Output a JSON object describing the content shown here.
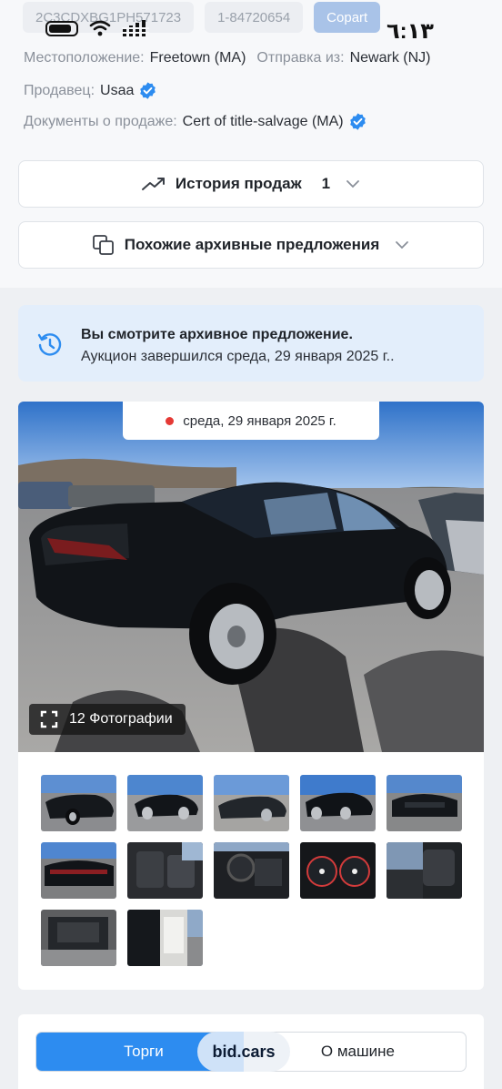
{
  "header": {
    "vin": "2C3CDXBG1PH571723",
    "lot": "1-84720654",
    "auction_brand": "Copart",
    "clock": "٦:١٣"
  },
  "details": {
    "location_label": "Местоположение:",
    "location_value": "Freetown (MA)",
    "ship_label": "Отправка из:",
    "ship_value": "Newark (NJ)",
    "seller_label": "Продавец:",
    "seller_value": "Usaa",
    "docs_label": "Документы о продаже:",
    "docs_value": "Cert of title-salvage (MA)"
  },
  "accordions": {
    "history_label": "История продаж",
    "history_count": "1",
    "similar_label": "Похожие архивные предложения"
  },
  "notice": {
    "title": "Вы смотрите архивное предложение.",
    "text": "Аукцион завершился среда, 29 января 2025 г.."
  },
  "gallery": {
    "date": "среда, 29 января 2025 г.",
    "photos_button": "12 Фотографии",
    "thumbnail_count": 12
  },
  "tabs": {
    "bidding": "Торги",
    "logo": "bid.cars",
    "about": "О машине"
  },
  "colors": {
    "accent": "#2d8cf0",
    "verified": "#2d8cf0",
    "notice_bg": "#e3eefb",
    "live_dot": "#e53935"
  }
}
